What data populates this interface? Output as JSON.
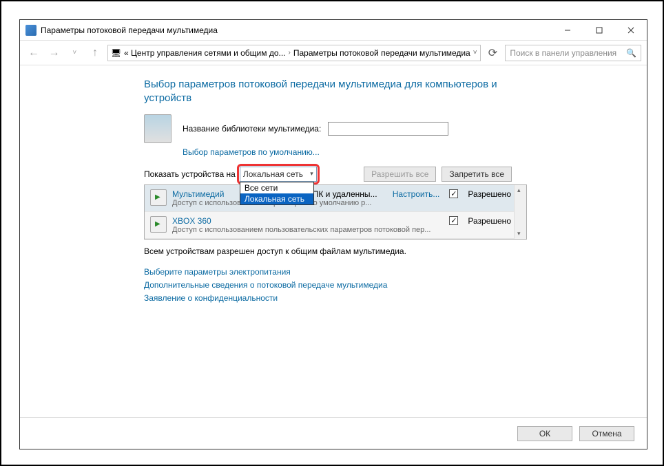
{
  "window": {
    "title": "Параметры потоковой передачи мультимедиа"
  },
  "toolbar": {
    "crumb1": "« Центр управления сетями и общим до...",
    "crumb1_sep": "›",
    "crumb2": "Параметры потоковой передачи мультимедиа",
    "search_placeholder": "Поиск в панели управления"
  },
  "main": {
    "heading": "Выбор параметров потоковой передачи мультимедиа для компьютеров и устройств",
    "libname_label": "Название библиотеки мультимедиа:",
    "libname_value": "",
    "defaults_link": "Выбор параметров по умолчанию...",
    "show_label": "Показать устройства на",
    "combo_value": "Локальная сеть",
    "combo_options": {
      "opt0": "Все сети",
      "opt1": "Локальная сеть"
    },
    "allow_all": "Разрешить все",
    "deny_all": "Запретить все",
    "devices": {
      "d0": {
        "title_prefix": "Мультимедий",
        "title_suffix": "ом ПК и удаленны...",
        "subtitle": "Доступ с использованием параметров по умолчанию р...",
        "config": "Настроить...",
        "allowed": "Разрешено"
      },
      "d1": {
        "title": "XBOX 360",
        "subtitle": "Доступ с использованием пользовательских параметров потоковой пер...",
        "allowed": "Разрешено"
      }
    },
    "summary": "Всем устройствам разрешен доступ к общим файлам мультимедиа.",
    "links": {
      "l0": "Выберите параметры электропитания",
      "l1": "Дополнительные сведения о потоковой передаче мультимедиа",
      "l2": "Заявление о конфиденциальности"
    }
  },
  "footer": {
    "ok": "ОК",
    "cancel": "Отмена"
  }
}
